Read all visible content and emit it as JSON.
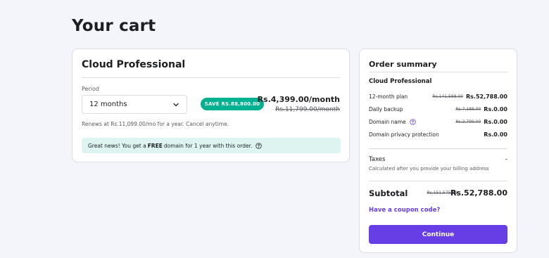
{
  "page": {
    "title": "Your cart"
  },
  "product": {
    "name": "Cloud Professional",
    "period_label": "Period",
    "period_value": "12 months",
    "save_badge": "SAVE RS.88,800.00",
    "price_now": "Rs.4,399.00/month",
    "price_old": "Rs.11,799.00/month",
    "renews_note": "Renews at Rs.11,099.00/mo for a year. Cancel anytime.",
    "promo": {
      "before": "Great news! You get a",
      "bold": "FREE",
      "after": "domain for 1 year with this order."
    }
  },
  "summary": {
    "title": "Order summary",
    "product_name": "Cloud Professional",
    "lines": [
      {
        "label": "12-month plan",
        "old": "Rs.141,588.00",
        "current": "Rs.52,788.00"
      },
      {
        "label": "Daily backup",
        "old": "Rs.7,188.00",
        "current": "Rs.0.00"
      },
      {
        "label": "Domain name",
        "old": "Rs.2,799.00",
        "current": "Rs.0.00"
      },
      {
        "label": "Domain privacy protection",
        "old": "",
        "current": "Rs.0.00"
      }
    ],
    "taxes_label": "Taxes",
    "taxes_value": "-",
    "taxes_note": "Calculated after you provide your billing address",
    "subtotal_label": "Subtotal",
    "subtotal_old": "Rs.151,575.00",
    "subtotal_now": "Rs.52,788.00",
    "coupon_label": "Have a coupon code?",
    "continue_label": "Continue"
  },
  "colors": {
    "accent": "#673de6",
    "save_badge": "#00b090",
    "promo_bg": "#def4f0"
  },
  "icons": {
    "select": "chevron-down-icon",
    "promo": "help-circle-icon",
    "domain": "help-circle-icon"
  }
}
